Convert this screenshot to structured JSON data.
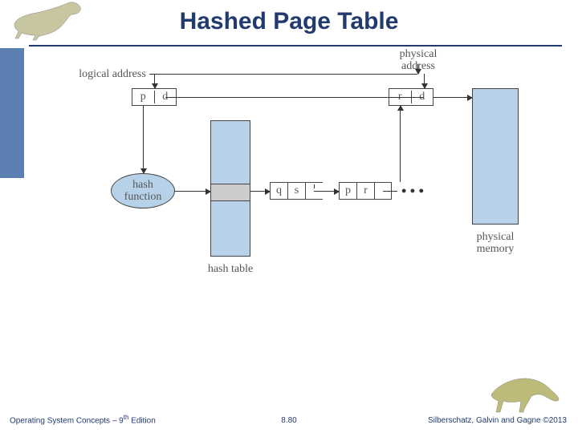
{
  "title": "Hashed Page Table",
  "labels": {
    "logical_address": "logical address",
    "physical_address": "physical\naddress",
    "hash_function": "hash\nfunction",
    "hash_table": "hash table",
    "physical_memory": "physical\nmemory",
    "dots": "• • •"
  },
  "logical_addr": {
    "p": "p",
    "d": "d"
  },
  "physical_addr": {
    "r": "r",
    "d": "d"
  },
  "chain_entry1": {
    "q": "q",
    "s": "s",
    "ptr": ""
  },
  "chain_entry2": {
    "p": "p",
    "r": "r",
    "ptr": ""
  },
  "footer": {
    "left_pre": "Operating System Concepts – 9",
    "left_sup": "th",
    "left_post": " Edition",
    "center": "8.80",
    "right": "Silberschatz, Galvin and Gagne ©2013"
  }
}
